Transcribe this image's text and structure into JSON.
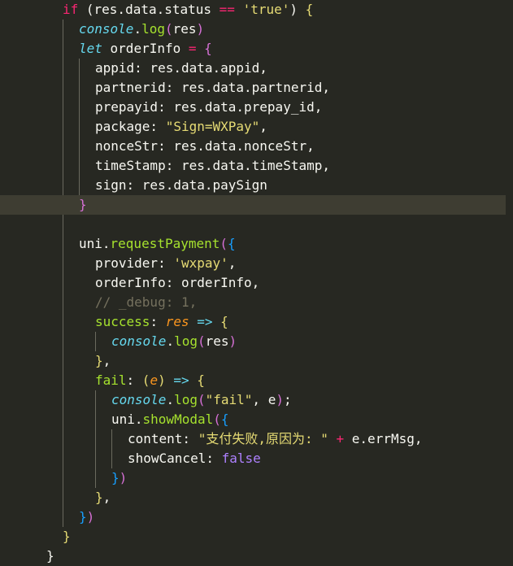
{
  "lines": [
    [
      {
        "t": "if",
        "c": "kw"
      },
      {
        "t": " ("
      },
      {
        "t": "res.data.status "
      },
      {
        "t": "==",
        "c": "kw"
      },
      {
        "t": " "
      },
      {
        "t": "'true'",
        "c": "str"
      },
      {
        "t": ") "
      },
      {
        "t": "{",
        "c": "br1"
      }
    ],
    [
      {
        "t": "console",
        "c": "cls"
      },
      {
        "t": "."
      },
      {
        "t": "log",
        "c": "func"
      },
      {
        "t": "(",
        "c": "br2"
      },
      {
        "t": "res"
      },
      {
        "t": ")",
        "c": "br2"
      }
    ],
    [
      {
        "t": "let",
        "c": "decl"
      },
      {
        "t": " orderInfo "
      },
      {
        "t": "=",
        "c": "kw"
      },
      {
        "t": " "
      },
      {
        "t": "{",
        "c": "br2"
      }
    ],
    [
      {
        "t": "appid: res.data.appid,"
      }
    ],
    [
      {
        "t": "partnerid: res.data.partnerid,"
      }
    ],
    [
      {
        "t": "prepayid: res.data.prepay_id,"
      }
    ],
    [
      {
        "t": "package: "
      },
      {
        "t": "\"Sign=WXPay\"",
        "c": "str"
      },
      {
        "t": ","
      }
    ],
    [
      {
        "t": "nonceStr: res.data.nonceStr,"
      }
    ],
    [
      {
        "t": "timeStamp: res.data.timeStamp,"
      }
    ],
    [
      {
        "t": "sign: res.data.paySign"
      }
    ],
    [
      {
        "t": "}",
        "c": "br2"
      }
    ],
    [],
    [
      {
        "t": "uni."
      },
      {
        "t": "requestPayment",
        "c": "func"
      },
      {
        "t": "(",
        "c": "br2"
      },
      {
        "t": "{",
        "c": "br3"
      }
    ],
    [
      {
        "t": "provider: "
      },
      {
        "t": "'wxpay'",
        "c": "str"
      },
      {
        "t": ","
      }
    ],
    [
      {
        "t": "orderInfo: orderInfo,"
      }
    ],
    [
      {
        "t": "// _debug: 1,",
        "c": "comment"
      }
    ],
    [
      {
        "t": "success",
        "c": "func"
      },
      {
        "t": ": "
      },
      {
        "t": "res",
        "c": "param"
      },
      {
        "t": " "
      },
      {
        "t": "=>",
        "c": "decl"
      },
      {
        "t": " "
      },
      {
        "t": "{",
        "c": "br1"
      }
    ],
    [
      {
        "t": "console",
        "c": "cls"
      },
      {
        "t": "."
      },
      {
        "t": "log",
        "c": "func"
      },
      {
        "t": "(",
        "c": "br2"
      },
      {
        "t": "res"
      },
      {
        "t": ")",
        "c": "br2"
      }
    ],
    [
      {
        "t": "}",
        "c": "br1"
      },
      {
        "t": ","
      }
    ],
    [
      {
        "t": "fail",
        "c": "func"
      },
      {
        "t": ": "
      },
      {
        "t": "(",
        "c": "br1"
      },
      {
        "t": "e",
        "c": "param"
      },
      {
        "t": ")",
        "c": "br1"
      },
      {
        "t": " "
      },
      {
        "t": "=>",
        "c": "decl"
      },
      {
        "t": " "
      },
      {
        "t": "{",
        "c": "br1"
      }
    ],
    [
      {
        "t": "console",
        "c": "cls"
      },
      {
        "t": "."
      },
      {
        "t": "log",
        "c": "func"
      },
      {
        "t": "(",
        "c": "br2"
      },
      {
        "t": "\"fail\"",
        "c": "str"
      },
      {
        "t": ", e"
      },
      {
        "t": ")",
        "c": "br2"
      },
      {
        "t": ";"
      }
    ],
    [
      {
        "t": "uni."
      },
      {
        "t": "showModal",
        "c": "func"
      },
      {
        "t": "(",
        "c": "br2"
      },
      {
        "t": "{",
        "c": "br3"
      }
    ],
    [
      {
        "t": "content: "
      },
      {
        "t": "\"支付失败,原因为: \"",
        "c": "str"
      },
      {
        "t": " "
      },
      {
        "t": "+",
        "c": "kw"
      },
      {
        "t": " e.errMsg,"
      }
    ],
    [
      {
        "t": "showCancel: "
      },
      {
        "t": "false",
        "c": "bool"
      }
    ],
    [
      {
        "t": "}",
        "c": "br3"
      },
      {
        "t": ")",
        "c": "br2"
      }
    ],
    [
      {
        "t": "}",
        "c": "br1"
      },
      {
        "t": ","
      }
    ],
    [
      {
        "t": "}",
        "c": "br3"
      },
      {
        "t": ")",
        "c": "br2"
      }
    ],
    [
      {
        "t": "}",
        "c": "br1"
      }
    ],
    [
      {
        "t": "}"
      }
    ]
  ]
}
